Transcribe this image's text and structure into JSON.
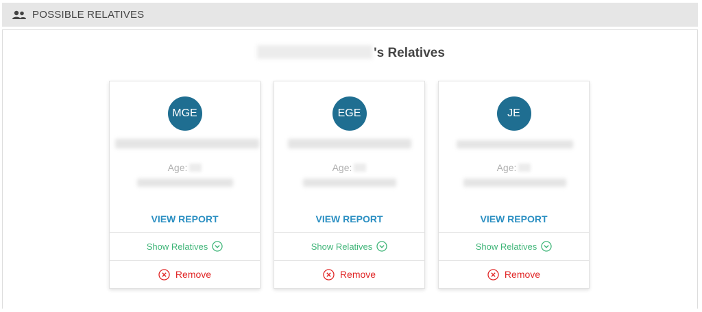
{
  "section": {
    "title": "POSSIBLE RELATIVES",
    "icon": "users-icon"
  },
  "heading": {
    "suffix": "'s Relatives"
  },
  "colors": {
    "avatar": "#1f6e91",
    "link": "#2b8fc2",
    "show": "#3fb578",
    "remove": "#e02424",
    "header_bg": "#e6e6e6"
  },
  "cards": [
    {
      "initials": "MGE",
      "age_label": "Age:",
      "view_report": "VIEW REPORT",
      "show_relatives": "Show Relatives",
      "remove": "Remove"
    },
    {
      "initials": "EGE",
      "age_label": "Age:",
      "view_report": "VIEW REPORT",
      "show_relatives": "Show Relatives",
      "remove": "Remove"
    },
    {
      "initials": "JE",
      "age_label": "Age:",
      "view_report": "VIEW REPORT",
      "show_relatives": "Show Relatives",
      "remove": "Remove"
    }
  ]
}
